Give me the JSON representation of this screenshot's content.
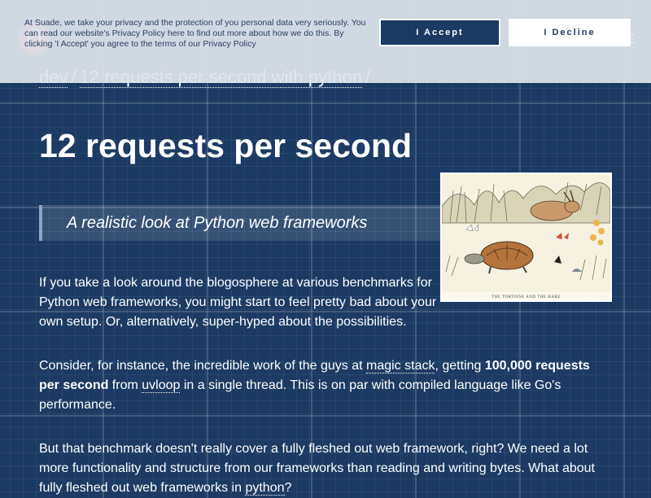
{
  "cookie": {
    "text": "At Suade, we take your privacy and the protection of you personal data very seriously. You can read our website's Privacy Policy here to find out more about how we do this. By clicking 'I Accept' you agree to the terms of our Privacy Policy",
    "accept_label": "I Accept",
    "decline_label": "I Decline"
  },
  "header": {
    "menu_label": "E",
    "breadcrumb": [
      "dev",
      "12 requests per second with python",
      ""
    ],
    "breadcrumb_sep": "/"
  },
  "article": {
    "title": "12 requests per second",
    "subtitle": "A realistic look at Python web frameworks",
    "image_caption": "THE TORTOISE AND THE HARE",
    "p1": "If you take a look around the blogosphere at various benchmarks for Python web frameworks, you might start to feel pretty bad about your own setup. Or, alternatively, super-hyped about the possibilities.",
    "p2_a": "Consider, for instance, the incredible work of the guys at ",
    "p2_link1": "magic stack",
    "p2_b": ", getting ",
    "p2_bold": "100,000 requests per second",
    "p2_c": " from ",
    "p2_link2": "uvloop",
    "p2_d": " in a single thread. This is on par with compiled language like Go's performance.",
    "p3_a": "But that benchmark doesn't really cover a fully fleshed out web framework, right? We need a lot more functionality and structure from our frameworks than reading and writing bytes. What about fully fleshed out web frameworks in ",
    "p3_link": "python",
    "p3_b": "?"
  },
  "colors": {
    "background": "#1b3a64",
    "cookie_bg": "#dee4ec",
    "accent_logo": "#e85a4f"
  }
}
